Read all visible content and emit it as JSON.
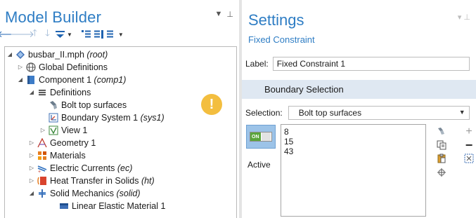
{
  "model_builder": {
    "title": "Model Builder",
    "tree": [
      {
        "label": "busbar_II.mph",
        "suffix": "(root)"
      },
      {
        "label": "Global Definitions",
        "suffix": ""
      },
      {
        "label": "Component 1",
        "suffix": "(comp1)"
      },
      {
        "label": "Definitions",
        "suffix": ""
      },
      {
        "label": "Bolt top surfaces",
        "suffix": ""
      },
      {
        "label": "Boundary System 1",
        "suffix": "(sys1)"
      },
      {
        "label": "View 1",
        "suffix": ""
      },
      {
        "label": "Geometry 1",
        "suffix": ""
      },
      {
        "label": "Materials",
        "suffix": ""
      },
      {
        "label": "Electric Currents",
        "suffix": "(ec)"
      },
      {
        "label": "Heat Transfer in Solids",
        "suffix": "(ht)"
      },
      {
        "label": "Solid Mechanics",
        "suffix": "(solid)"
      },
      {
        "label": "Linear Elastic Material 1",
        "suffix": ""
      }
    ],
    "warning_symbol": "!"
  },
  "settings": {
    "title": "Settings",
    "subtitle": "Fixed Constraint",
    "label_caption": "Label:",
    "label_value": "Fixed Constraint 1",
    "section_title": "Boundary Selection",
    "selection_caption": "Selection:",
    "selection_value": "Bolt top surfaces",
    "toggle_text": "ON",
    "active_label": "Active",
    "selected_boundaries": [
      "8",
      "15",
      "43"
    ]
  },
  "colors": {
    "accent": "#2e7dc4",
    "section_bg": "#dfe8f2",
    "warning": "#f3be3f",
    "toggle_on": "#5aa53b"
  }
}
